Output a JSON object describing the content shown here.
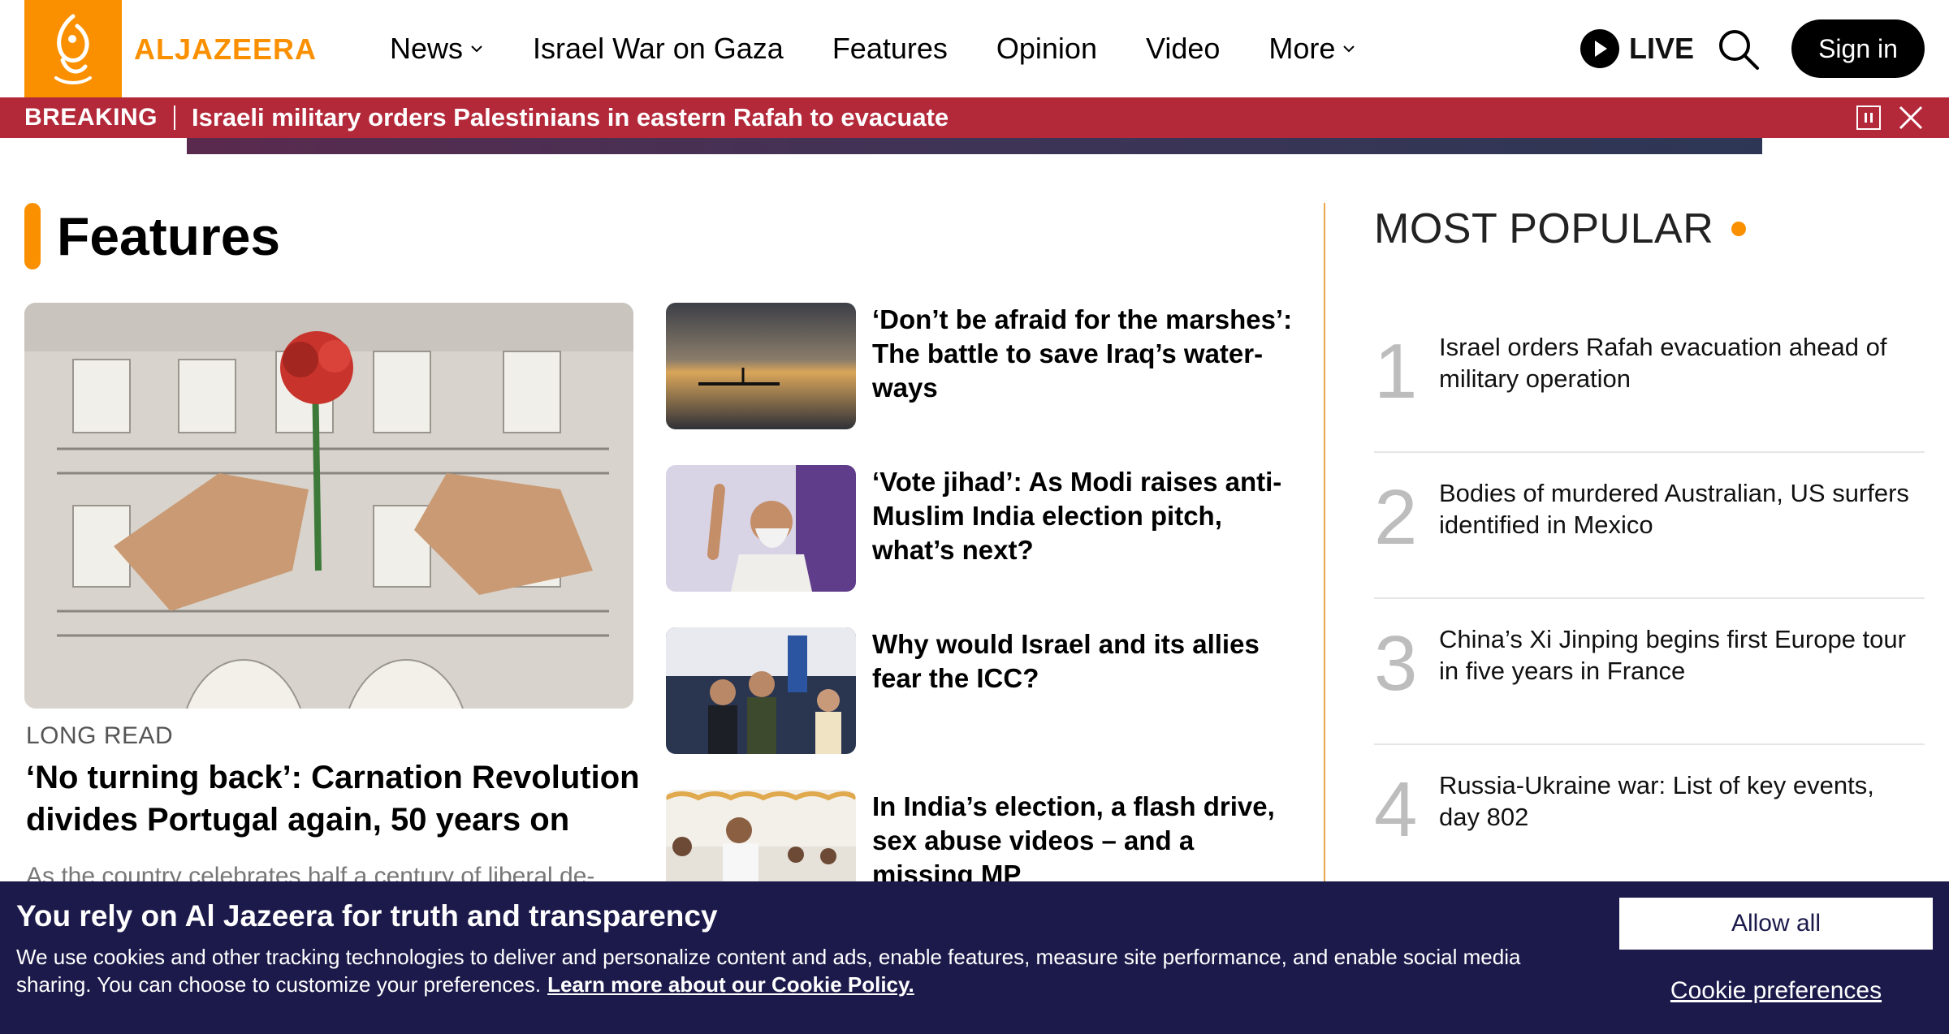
{
  "brand": {
    "wordmark": "ALJAZEERA",
    "accent": "#fa9000"
  },
  "nav": {
    "items": [
      {
        "label": "News",
        "dropdown": true
      },
      {
        "label": "Israel War on Gaza",
        "dropdown": false
      },
      {
        "label": "Features",
        "dropdown": false
      },
      {
        "label": "Opinion",
        "dropdown": false
      },
      {
        "label": "Video",
        "dropdown": false
      },
      {
        "label": "More",
        "dropdown": true
      }
    ],
    "live_label": "LIVE",
    "signin_label": "Sign in"
  },
  "breaking": {
    "label": "BREAKING",
    "text": "Israeli military orders Palestinians in eastern Rafah to evacuate",
    "color": "#b3293a"
  },
  "features": {
    "heading": "Features",
    "hero": {
      "tag": "LONG READ",
      "title": "‘No turning back’: Carnation Revolution di­vides Portugal again, 50 years on",
      "excerpt": "As the country celebrates half a century of liberal de-"
    },
    "cards": [
      {
        "title": "‘Don’t be afraid for the marshes’: The battle to save Iraq’s water­ways"
      },
      {
        "title": "‘Vote jihad’: As Modi raises anti-Muslim India election pitch, what’s next?"
      },
      {
        "title": "Why would Israel and its allies fear the ICC?"
      },
      {
        "title": "In India’s election, a flash drive, sex abuse videos – and a missing MP"
      }
    ]
  },
  "most_popular": {
    "heading": "MOST POPULAR",
    "items": [
      {
        "rank": "1",
        "title": "Israel orders Rafah evacuation ahead of military operation"
      },
      {
        "rank": "2",
        "title": "Bodies of murdered Australian, US surfers identified in Mexico"
      },
      {
        "rank": "3",
        "title": "China’s Xi Jinping begins first Europe tour in five years in France"
      },
      {
        "rank": "4",
        "title": "Russia-Ukraine war: List of key events, day 802"
      }
    ]
  },
  "cookie": {
    "title": "You rely on Al Jazeera for truth and transparency",
    "body": "We use cookies and other tracking technologies to deliver and personalize content and ads, enable features, measure site performance, and enable social media sharing. You can choose to customize your preferences.",
    "link": "Learn more about our Cookie Policy.",
    "allow_label": "Allow all",
    "preferences_label": "Cookie preferences",
    "bg_color": "#1b1a4b"
  }
}
